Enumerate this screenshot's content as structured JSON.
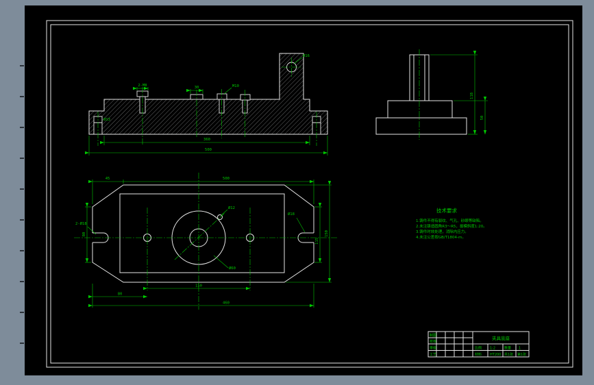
{
  "colors": {
    "app_bg": "#7e8c9a",
    "sheet_bg": "#000000",
    "line": "#e6e6e6",
    "dim": "#00c800"
  },
  "notes": {
    "title": "技术要求",
    "lines": [
      "1.铸件不得有裂纹、气孔、砂眼等缺陷。",
      "2.未注铸造圆角R3～R5，拔模斜度1:20。",
      "3.铸件时效处理，消除内应力。",
      "4.未注公差按GB/T1804-m。"
    ]
  },
  "dims": {
    "sec_screws": "2-M8",
    "sec_boss": "30",
    "sec_screw2": "M10",
    "sec_hole": "Ø16",
    "sec_flange_hole": "Ø13",
    "sec_width_inner": "360",
    "sec_width_outer": "500",
    "end_height": "118",
    "end_base": "50",
    "plan_top": "500",
    "plan_chamfer": "45",
    "plan_right_outer": "150",
    "plan_right_inner": "115",
    "plan_left": "80",
    "plan_bottom_holes": "150",
    "plan_bottom_left": "80",
    "plan_bottom_overall": "460",
    "plan_slots": "2-Ø18",
    "plan_slot_right": "Ø18",
    "plan_hole": "Ø12",
    "plan_center_hole": "Ø60"
  },
  "title_block": {
    "drawn": "制图",
    "checked": "校核",
    "approved": "审核",
    "process": "工艺",
    "part_name": "夹具底座",
    "scale_label": "比例",
    "scale_value": "1:2",
    "qty_label": "数量",
    "qty_value": "1",
    "material_label": "材料",
    "material_value": "HT200",
    "sheets": "共1张",
    "sheet_no": "第1张"
  }
}
